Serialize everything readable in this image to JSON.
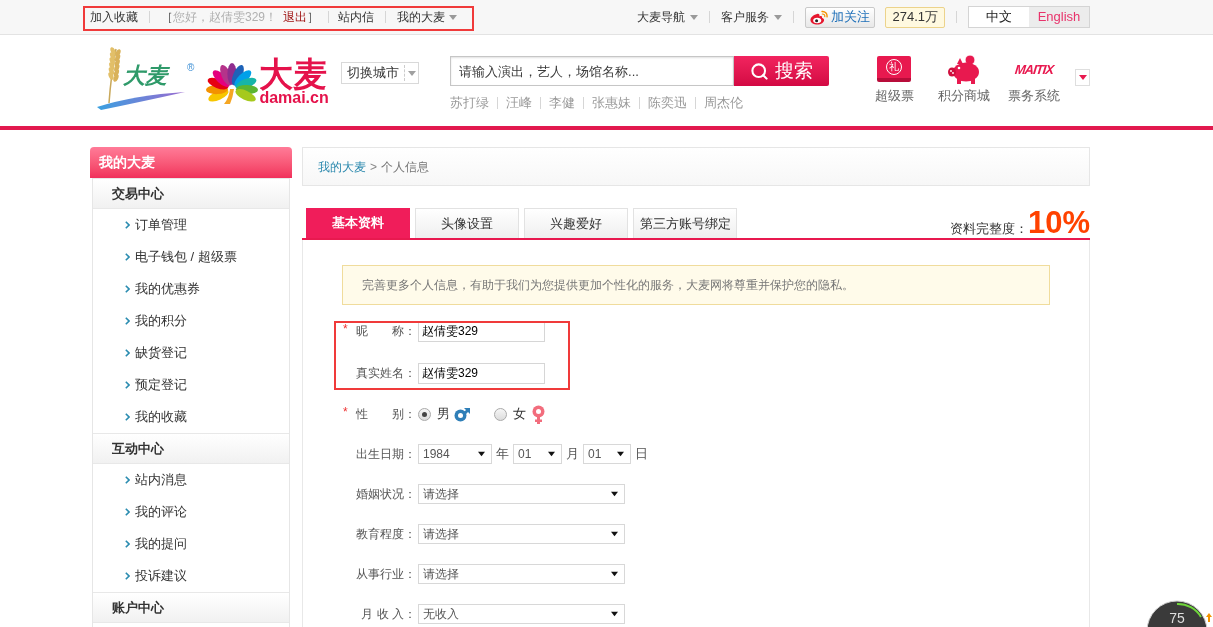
{
  "top_bar": {
    "highlighted": true,
    "favorite": "加入收藏",
    "greeting": {
      "open": "［",
      "text": "您好，赵倩雯329！",
      "logout": "退出",
      "close": "］"
    },
    "messages": "站内信",
    "account_menu": "我的大麦",
    "menus": [
      "大麦导航",
      "客户服务"
    ],
    "weibo": {
      "follow": "加关注",
      "count": "274.1万"
    },
    "languages": [
      {
        "label": "中文",
        "selected": true
      },
      {
        "label": "English",
        "selected": false
      }
    ]
  },
  "header": {
    "wheat_logo": {
      "text": "大麦",
      "mark": "®"
    },
    "brand": {
      "name": "大麦",
      "domain": "damai.cn"
    },
    "city_switch": "切换城市",
    "search": {
      "placeholder": "请输入演出，艺人，场馆名称...",
      "button": "搜索"
    },
    "hot_keywords": [
      "苏打绿",
      "汪峰",
      "李健",
      "张惠妹",
      "陈奕迅",
      "周杰伦"
    ],
    "shortcuts": [
      {
        "kind": "ticket",
        "emblem": "礼",
        "label": "超级票"
      },
      {
        "kind": "piggy",
        "label": "积分商城"
      },
      {
        "kind": "logo",
        "emblem": "MAITIX",
        "label": "票务系统"
      }
    ]
  },
  "sidebar": {
    "title": "我的大麦",
    "sections": [
      {
        "title": "交易中心",
        "items": [
          {
            "label": "订单管理"
          },
          {
            "label": "电子钱包 / 超级票"
          },
          {
            "label": "我的优惠券"
          },
          {
            "label": "我的积分"
          },
          {
            "label": "缺货登记"
          },
          {
            "label": "预定登记"
          },
          {
            "label": "我的收藏"
          }
        ]
      },
      {
        "title": "互动中心",
        "items": [
          {
            "label": "站内消息"
          },
          {
            "label": "我的评论"
          },
          {
            "label": "我的提问"
          },
          {
            "label": "投诉建议"
          }
        ]
      },
      {
        "title": "账户中心"
      }
    ]
  },
  "main": {
    "breadcrumb": {
      "link": "我的大麦",
      "separator": ">",
      "current": "个人信息"
    },
    "tabs": [
      {
        "label": "基本资料",
        "selected": true
      },
      {
        "label": "头像设置",
        "selected": false
      },
      {
        "label": "兴趣爱好",
        "selected": false
      },
      {
        "label": "第三方账号绑定",
        "selected": false
      }
    ],
    "completeness": {
      "label": "资料完整度：",
      "value": "10%"
    },
    "notice": "完善更多个人信息，有助于我们为您提供更加个性化的服务，大麦网将尊重并保护您的隐私。",
    "form": {
      "blocks": [
        {
          "highlighted": true,
          "rows": [
            {
              "kind": "text",
              "required_mark": "*",
              "label": "昵　　称：",
              "value": "赵倩雯329"
            },
            {
              "kind": "text",
              "label": "真实姓名：",
              "value": "赵倩雯329"
            }
          ]
        },
        {
          "rows": [
            {
              "kind": "radio",
              "required_mark": "*",
              "label": "性　　别：",
              "options": [
                {
                  "label": "男",
                  "selected": true
                },
                {
                  "label": "女",
                  "selected": false
                }
              ]
            },
            {
              "kind": "date",
              "label": "出生日期：",
              "parts": [
                {
                  "value": "1984",
                  "unit": "年"
                },
                {
                  "value": "01",
                  "unit": "月"
                },
                {
                  "value": "01",
                  "unit": "日"
                }
              ]
            },
            {
              "kind": "select",
              "label": "婚姻状况：",
              "value": "请选择"
            },
            {
              "kind": "select",
              "label": "教育程度：",
              "value": "请选择"
            },
            {
              "kind": "select",
              "label": "从事行业：",
              "value": "请选择"
            },
            {
              "kind": "select",
              "label": "月 收 入：",
              "value": "无收入"
            }
          ]
        }
      ]
    }
  },
  "floating_widget": {
    "reading": "75"
  }
}
